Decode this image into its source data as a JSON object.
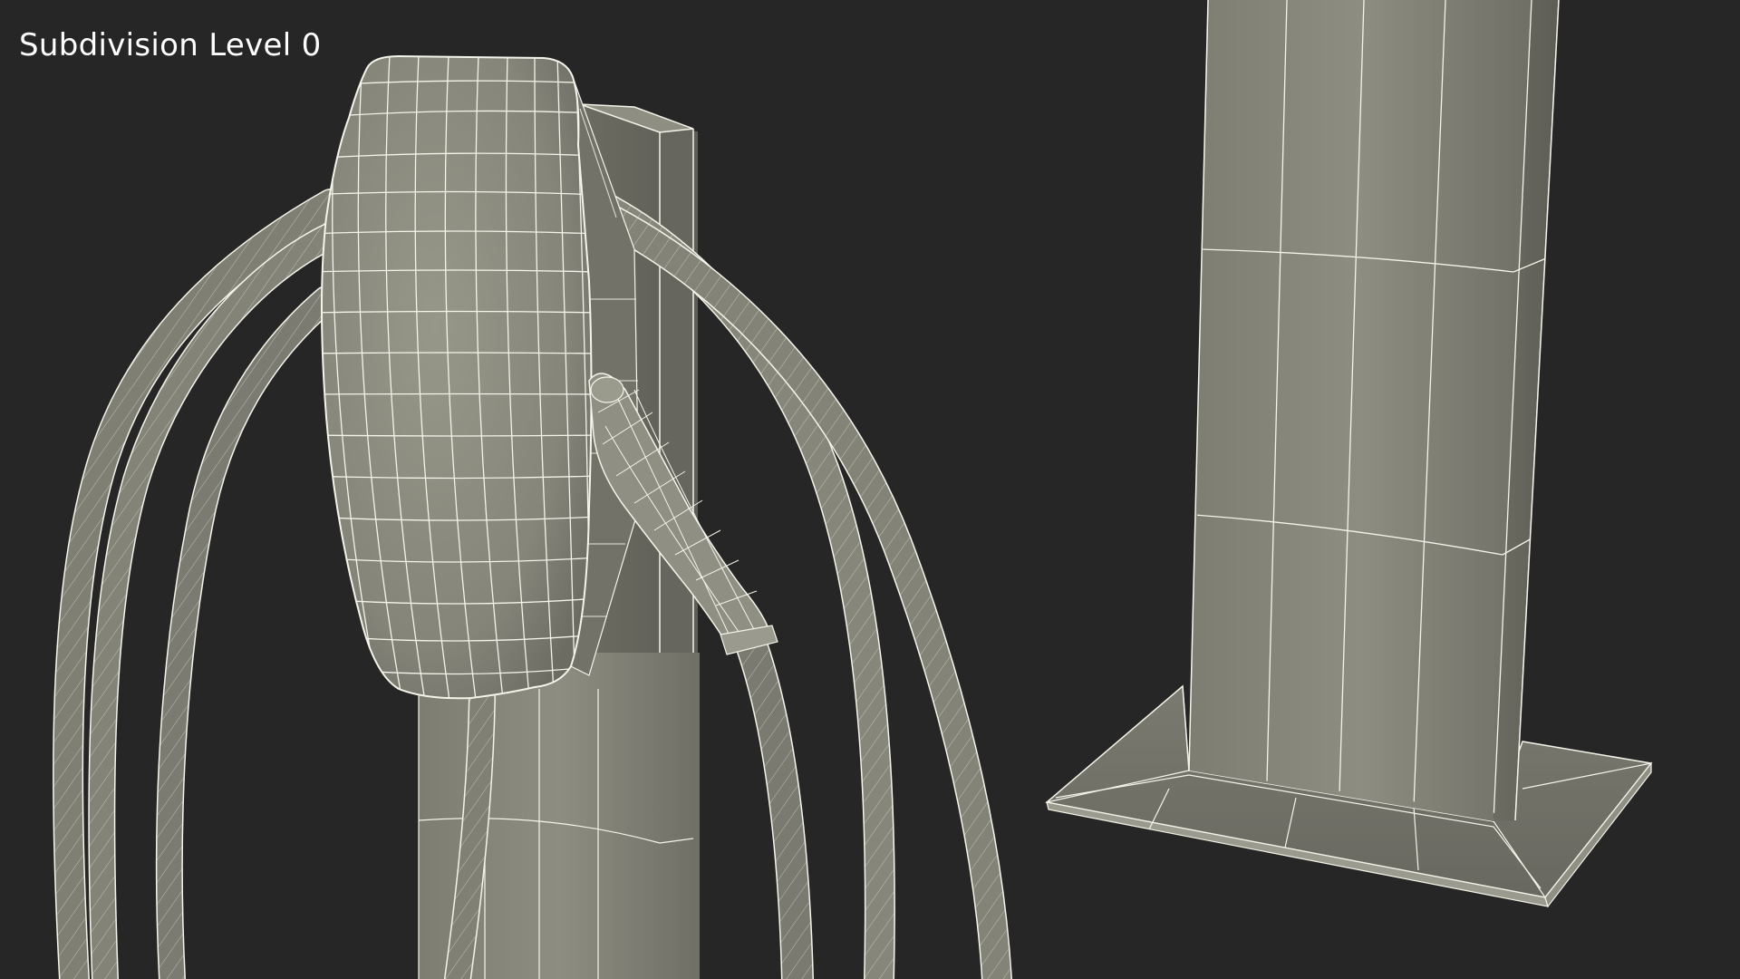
{
  "viewport": {
    "label": "Subdivision Level 0",
    "background_color": "#262626"
  },
  "scene": {
    "wireframe_color": "#f4f4ea",
    "mesh_color": "#8a8a7e"
  }
}
